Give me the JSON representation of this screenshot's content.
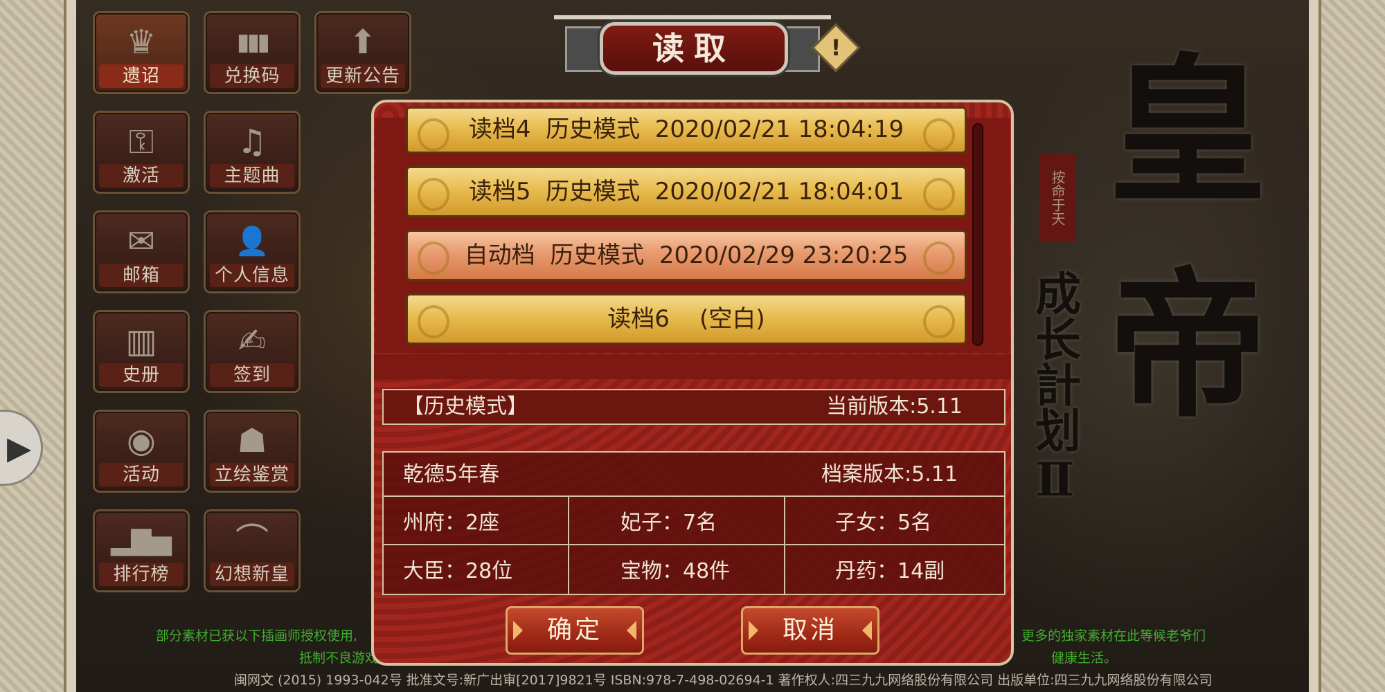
{
  "header": {
    "title": "读取",
    "warn_symbol": "!"
  },
  "left_menu": [
    {
      "label": "遗诏",
      "icon": "crown-icon",
      "glyph": "♛",
      "active": true
    },
    {
      "label": "兑换码",
      "icon": "code-icon",
      "glyph": "▮▮▮"
    },
    {
      "label": "更新公告",
      "icon": "arrow-up-icon",
      "glyph": "⬆"
    },
    {
      "label": "激活",
      "icon": "key-icon",
      "glyph": "⚿"
    },
    {
      "label": "主题曲",
      "icon": "music-icon",
      "glyph": "♫"
    },
    {
      "label": "邮箱",
      "icon": "mail-icon",
      "glyph": "✉"
    },
    {
      "label": "个人信息",
      "icon": "person-icon",
      "glyph": "👤"
    },
    {
      "label": "史册",
      "icon": "scroll-icon",
      "glyph": "▥"
    },
    {
      "label": "签到",
      "icon": "signin-icon",
      "glyph": "✍"
    },
    {
      "label": "活动",
      "icon": "drum-icon",
      "glyph": "◉"
    },
    {
      "label": "立绘鉴赏",
      "icon": "portrait-icon",
      "glyph": "☗"
    },
    {
      "label": "排行榜",
      "icon": "podium-icon",
      "glyph": "▂▇▅"
    },
    {
      "label": "幻想新皇",
      "icon": "hat-icon",
      "glyph": "⌒"
    }
  ],
  "side_arrow": "▶",
  "save_slots": [
    {
      "text": "读档4  历史模式  2020/02/21 18:04:19"
    },
    {
      "text": "读档5  历史模式  2020/02/21 18:04:01"
    },
    {
      "text": "自动档  历史模式  2020/02/29 23:20:25",
      "selected": true
    },
    {
      "text": "读档6    (空白)"
    }
  ],
  "info": {
    "mode": "【历史模式】",
    "current_version": "当前版本:5.11",
    "date": "乾德5年春",
    "save_version": "档案版本:5.11",
    "stats": [
      [
        "州府：2座",
        "妃子：7名",
        "子女：5名"
      ],
      [
        "大臣：28位",
        "宝物：48件",
        "丹药：14副"
      ]
    ]
  },
  "buttons": {
    "confirm": "确定",
    "cancel": "取消"
  },
  "title_art": {
    "big1": "皇",
    "big2": "帝",
    "sub": "成长計划Ⅱ",
    "seal": "按命于天"
  },
  "footer": {
    "line1_left": "部分素材已获以下插画师授权使用,",
    "line1_right": "更多的独家素材在此等候老爷们",
    "line2_left": "抵制不良游戏,",
    "line2_right": "健康生活。",
    "line3": "闽网文 (2015) 1993-042号  批准文号:新广出审[2017]9821号  ISBN:978-7-498-02694-1  著作权人:四三九九网络股份有限公司 出版单位:四三九九网络股份有限公司"
  }
}
